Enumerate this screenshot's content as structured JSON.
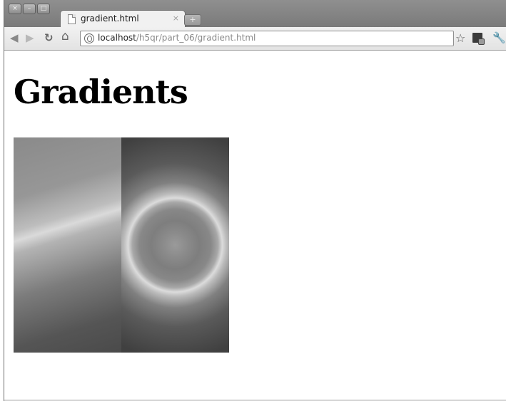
{
  "window": {
    "controls": {
      "close": "×",
      "minimize": "–",
      "maximize": "□"
    }
  },
  "tabs": [
    {
      "title": "gradient.html",
      "close": "×",
      "icon": "page-icon"
    }
  ],
  "new_tab": "+",
  "toolbar": {
    "back": "◀",
    "forward": "▶",
    "reload": "↻",
    "home": "⌂",
    "address": {
      "host": "localhost",
      "path": "/h5qr/part_06/gradient.html"
    },
    "bookmark_star": "☆",
    "wrench": "🔧"
  },
  "page": {
    "heading": "Gradients"
  },
  "colors": {
    "tabstrip": "#858585",
    "toolbar": "#e8e8e8",
    "page_bg": "#ffffff"
  }
}
